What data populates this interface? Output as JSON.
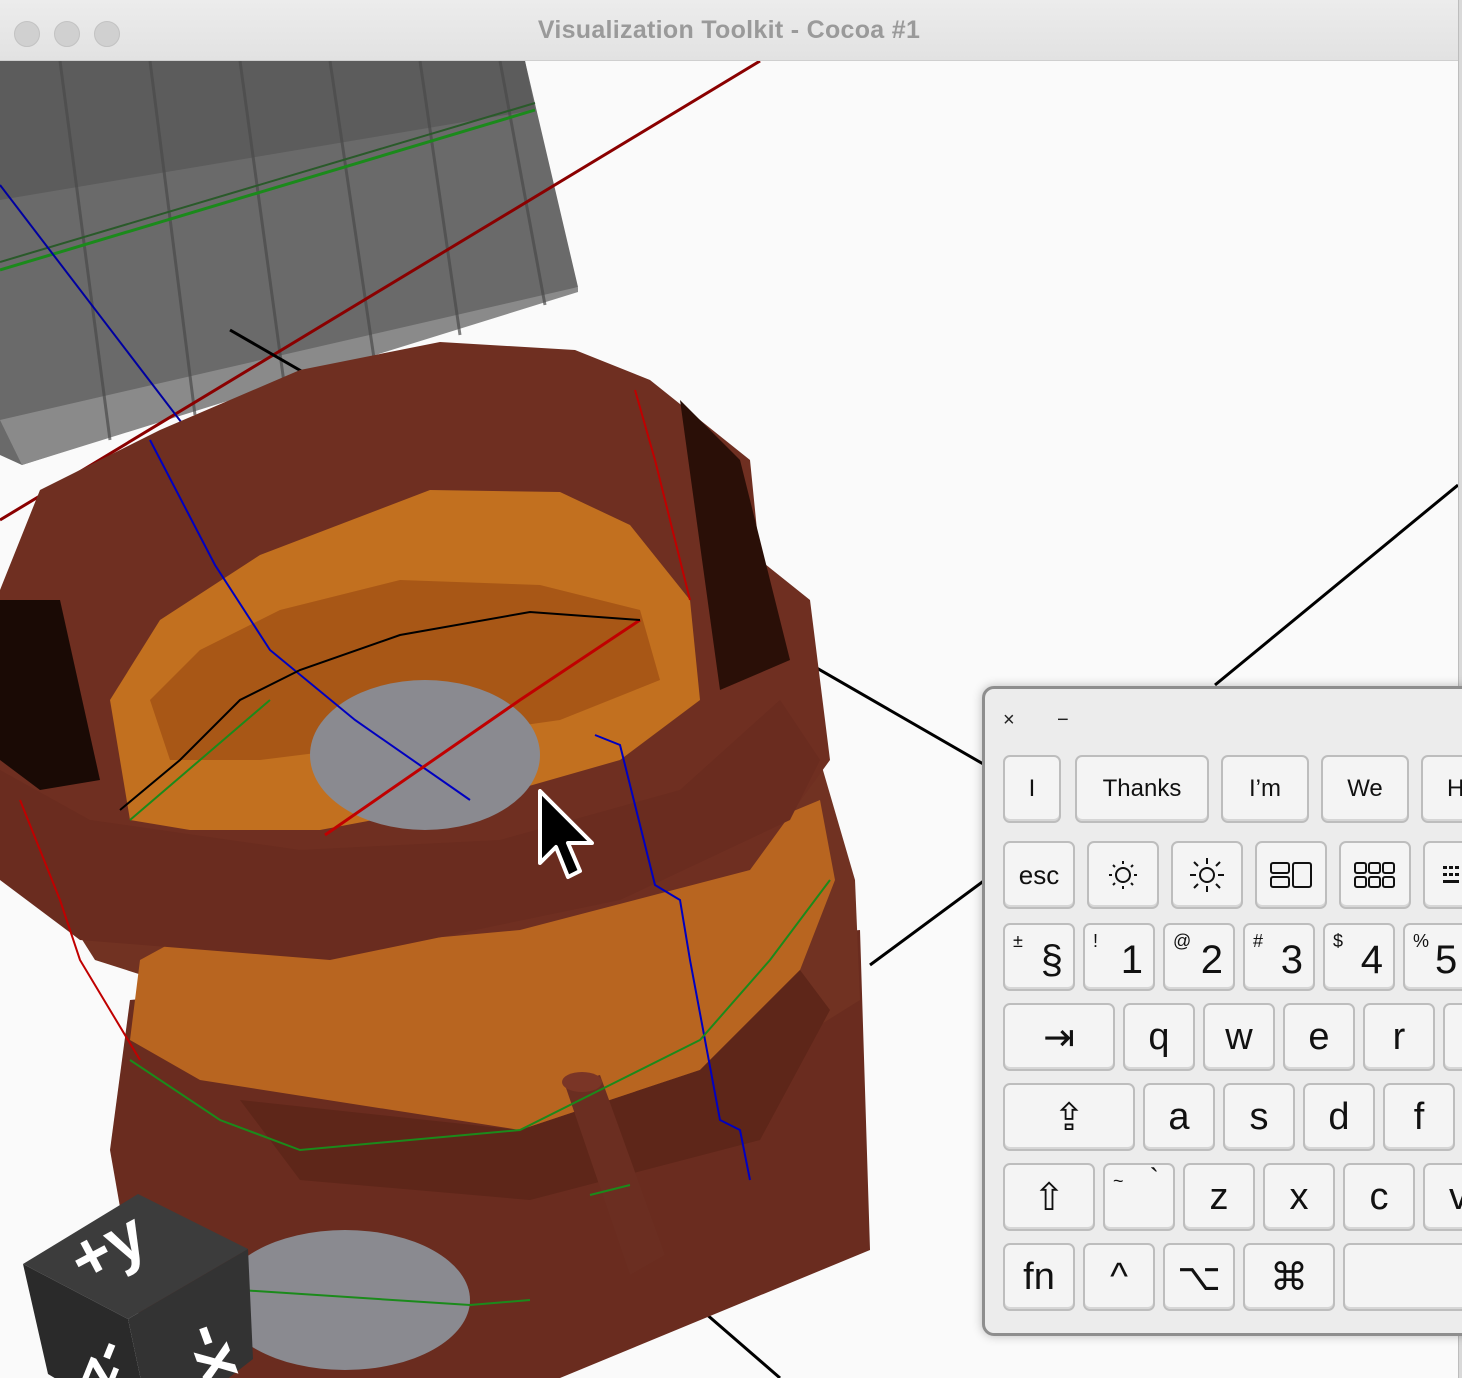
{
  "window": {
    "title": "Visualization Toolkit - Cocoa #1",
    "colors": {
      "titlebar_text": "#9a9a9a",
      "viewport_bg": "#fafafa"
    }
  },
  "viewport": {
    "scene_colors": {
      "barrel_wood": "#6b2e21",
      "barrel_inner": "#c46f22",
      "plate": "#6e6e6e",
      "disc": "#8a8a90",
      "axis_red": "#b00000",
      "axis_green": "#1b8a1b",
      "axis_blue": "#0000c0"
    },
    "orientation_cube": {
      "faces": [
        "+y",
        "-x",
        "-z"
      ]
    }
  },
  "cursor": {
    "icon": "arrow-pointer-icon"
  },
  "keyboard": {
    "close_label": "×",
    "minimize_label": "−",
    "suggestions": [
      "I",
      "Thanks",
      "I’m",
      "We",
      "H"
    ],
    "function_row": {
      "esc": "esc",
      "icons": [
        "brightness-down-icon",
        "brightness-up-icon",
        "mission-control-icon",
        "launchpad-icon",
        "keyboard-brightness-icon"
      ]
    },
    "number_row": [
      {
        "sup": "±",
        "main": "§"
      },
      {
        "sup": "!",
        "main": "1"
      },
      {
        "sup": "@",
        "main": "2"
      },
      {
        "sup": "#",
        "main": "3"
      },
      {
        "sup": "$",
        "main": "4"
      },
      {
        "sup": "%",
        "main": "5"
      }
    ],
    "qwerty_row": {
      "tab": "⇥",
      "keys": [
        "q",
        "w",
        "e",
        "r"
      ]
    },
    "home_row": {
      "caps": "⇪",
      "keys": [
        "a",
        "s",
        "d",
        "f"
      ]
    },
    "bottom_alpha_row": {
      "shift": "⇧",
      "tilde_sup": "~",
      "tilde_main": "`",
      "keys": [
        "z",
        "x",
        "c",
        "v"
      ]
    },
    "modifier_row": {
      "fn": "fn",
      "control": "^",
      "option": "⌥",
      "command": "⌘"
    }
  }
}
